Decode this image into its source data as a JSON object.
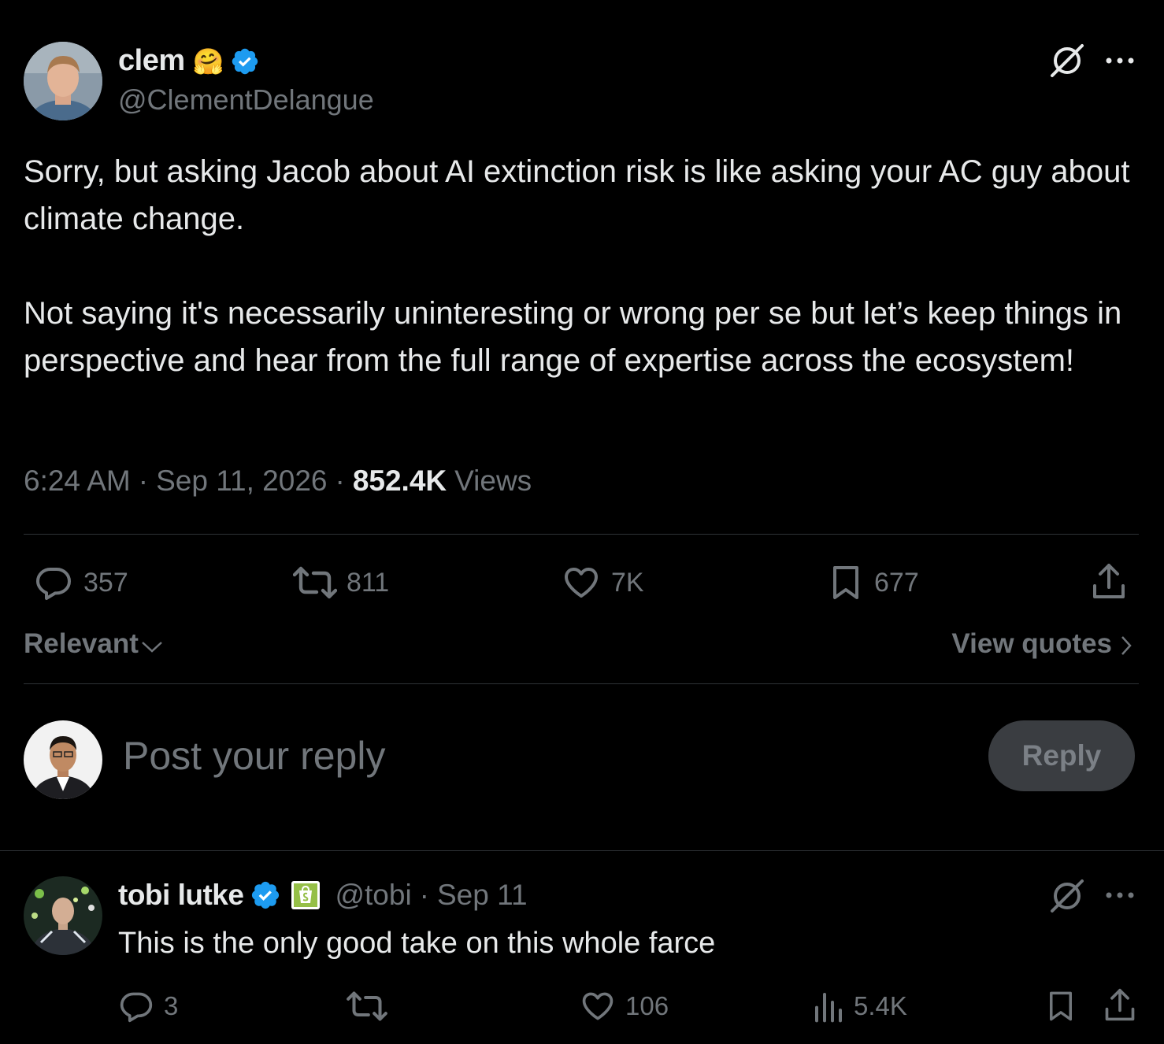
{
  "tweet": {
    "name": "clem",
    "emoji": "🤗",
    "handle": "@ClementDelangue",
    "text_p1": "Sorry, but asking Jacob about AI extinction risk is like asking your AC guy about climate change.",
    "text_p2": "Not saying it's necessarily uninteresting or wrong per se but let’s keep things in perspective and hear from the full range of expertise across the ecosystem!",
    "time": "6:24 AM",
    "date": "Sep 11, 2026",
    "views_count": "852.4K",
    "views_label": "Views",
    "replies": "357",
    "reposts": "811",
    "likes": "7K",
    "bookmarks": "677"
  },
  "filter": {
    "sort_label": "Relevant",
    "view_quotes_label": "View quotes"
  },
  "composer": {
    "placeholder": "Post your reply",
    "reply_button": "Reply"
  },
  "reply": {
    "name": "tobi lutke",
    "handle": "@tobi",
    "date": "Sep 11",
    "text": "This is the only good take on this whole farce",
    "replies": "3",
    "likes": "106",
    "views": "5.4K"
  },
  "colors": {
    "background": "#000000",
    "text": "#e7e9ea",
    "muted": "#71767b",
    "verified": "#1d9bf0",
    "divider": "#2f3336",
    "reply_button_bg": "#3a3d41",
    "shopify_green": "#95bf47"
  }
}
